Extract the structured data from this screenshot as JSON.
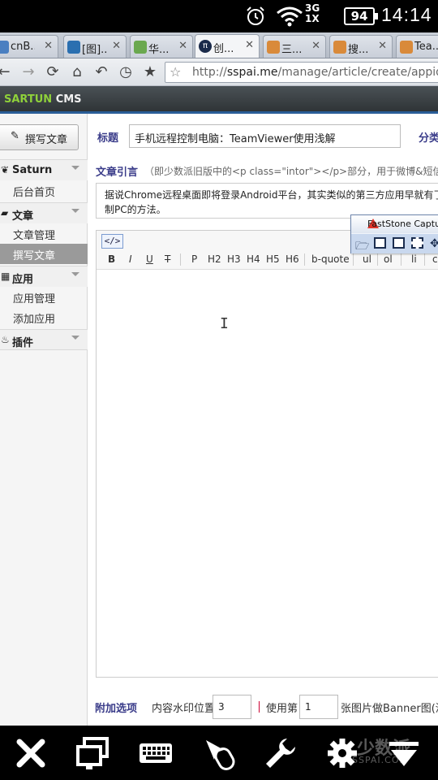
{
  "status_bar": {
    "network": [
      "3G",
      "1X"
    ],
    "battery": "94",
    "time": "14:14"
  },
  "tabs": [
    {
      "label": "cnB...",
      "active": false,
      "favicon_color": "#4a7fc1"
    },
    {
      "label": "[图]...",
      "active": false,
      "favicon_color": "#2a6fb0"
    },
    {
      "label": "华...",
      "active": false,
      "favicon_color": "#6aa84f"
    },
    {
      "label": "创...",
      "active": true,
      "favicon_color": "#1a2a4a"
    },
    {
      "label": "三...",
      "active": false,
      "favicon_color": "#d98a3a"
    },
    {
      "label": "搜...",
      "active": false,
      "favicon_color": "#d98a3a"
    },
    {
      "label": "Tea...",
      "active": false,
      "favicon_color": "#d98a3a"
    }
  ],
  "address_bar": {
    "url_prefix": "http://",
    "url_domain": "sspai.me",
    "url_path": "/manage/article/create/appid/"
  },
  "cms": {
    "brand_green": "SARTUN",
    "brand_white": "CMS"
  },
  "sidebar": {
    "write_button": "撰写文章",
    "sections": [
      {
        "label": "Saturn",
        "icon": "leaf-icon",
        "items": [
          "后台首页"
        ]
      },
      {
        "label": "文章",
        "icon": "folder-icon",
        "items": [
          "文章管理",
          "撰写文章"
        ]
      },
      {
        "label": "应用",
        "icon": "grid-icon",
        "items": [
          "应用管理",
          "添加应用"
        ]
      },
      {
        "label": "插件",
        "icon": "fire-icon",
        "items": []
      }
    ],
    "active_item": "撰写文章"
  },
  "form": {
    "title_label": "标题",
    "title_value": "手机远程控制电脑：TeamViewer使用浅解",
    "category_label": "分类",
    "intro_label": "文章引言",
    "intro_hint": "（即少数派旧版中的<p class=\"intor\"></p>部分，用于微博&短信分享",
    "intro_line1": "据说Chrome远程桌面即将登录Android平台，其实类似的第三方应用早就有了，",
    "intro_line2": "制PC的方法。",
    "toolbar": {
      "source": "</>",
      "buttons": [
        "B",
        "I",
        "U",
        "T",
        "P",
        "H2",
        "H3",
        "H4",
        "H5",
        "H6",
        "b-quote",
        "ul",
        "ol",
        "li",
        "c"
      ]
    },
    "extras": {
      "label": "附加选项",
      "watermark_label": "内容水印位置",
      "watermark_value": "3",
      "use_label": "使用第",
      "use_value": "1",
      "banner_text": "张图片做Banner图(没有"
    }
  },
  "faststone": {
    "title": "FastStone Capture"
  },
  "watermark": {
    "text": "少数派",
    "sub": "SSPAI.COM"
  }
}
